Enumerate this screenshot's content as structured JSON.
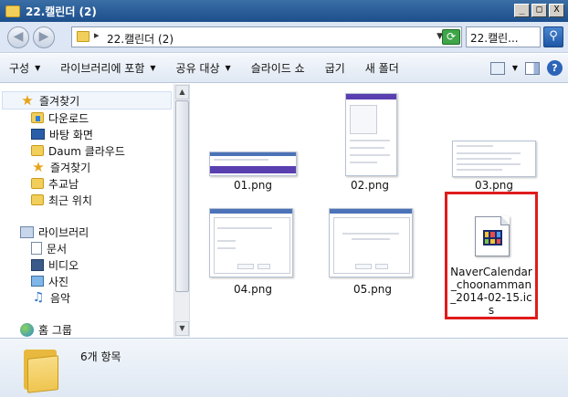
{
  "window": {
    "title": "22.캘린더 (2)",
    "buttons": [
      "_",
      "□",
      "X"
    ]
  },
  "address": {
    "path": "22.캘린더 (2)",
    "search_value": "22.캘린..."
  },
  "toolbar": {
    "items": [
      "구성",
      "라이브러리에 포함",
      "공유 대상",
      "슬라이드 쇼",
      "굽기",
      "새 폴더"
    ],
    "help": "?"
  },
  "nav": {
    "favorites_header": "즐겨찾기",
    "favorites": [
      "다운로드",
      "바탕 화면",
      "Daum 클라우드",
      "즐겨찾기",
      "추교남",
      "최근 위치"
    ],
    "libraries_header": "라이브러리",
    "libraries": [
      "문서",
      "비디오",
      "사진",
      "음악"
    ],
    "homegroup": "홈 그룹"
  },
  "files": [
    {
      "name": "01.png"
    },
    {
      "name": "02.png"
    },
    {
      "name": "03.png"
    },
    {
      "name": "04.png"
    },
    {
      "name": "05.png"
    },
    {
      "name": "NaverCalendar_choonamman_2014-02-15.ics"
    }
  ],
  "status": {
    "count_label": "6개 항목"
  },
  "colors": {
    "selection_border": "#e01b1b",
    "title_bar": "#1d4f8c"
  }
}
